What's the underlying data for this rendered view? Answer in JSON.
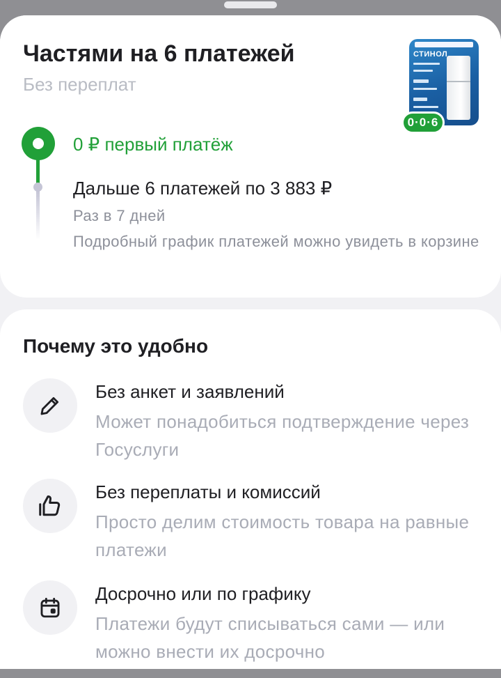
{
  "installment": {
    "title": "Частями на 6 платежей",
    "subtitle": "Без переплат",
    "first_payment": "0 ₽ первый платёж",
    "next_payments": "Дальше 6 платежей по 3 883 ₽",
    "frequency": "Раз в 7 дней",
    "details": "Подробный график платежей можно увидеть в корзине",
    "badge": "0·0·6",
    "product_brand": "СТИНОЛ"
  },
  "why": {
    "title": "Почему это удобно",
    "features": [
      {
        "icon": "pencil-icon",
        "title": "Без анкет и заявлений",
        "description": "Может понадобиться подтверждение через Госуслуги"
      },
      {
        "icon": "thumbs-up-icon",
        "title": "Без переплаты и комиссий",
        "description": "Просто делим стоимость товара на равные платежи"
      },
      {
        "icon": "calendar-icon",
        "title": "Досрочно или по графику",
        "description": "Платежи будут списываться сами — или можно внести их досрочно"
      }
    ]
  },
  "colors": {
    "accent_green": "#21a038",
    "text_primary": "#1f1f23",
    "text_secondary": "#8d909a"
  }
}
